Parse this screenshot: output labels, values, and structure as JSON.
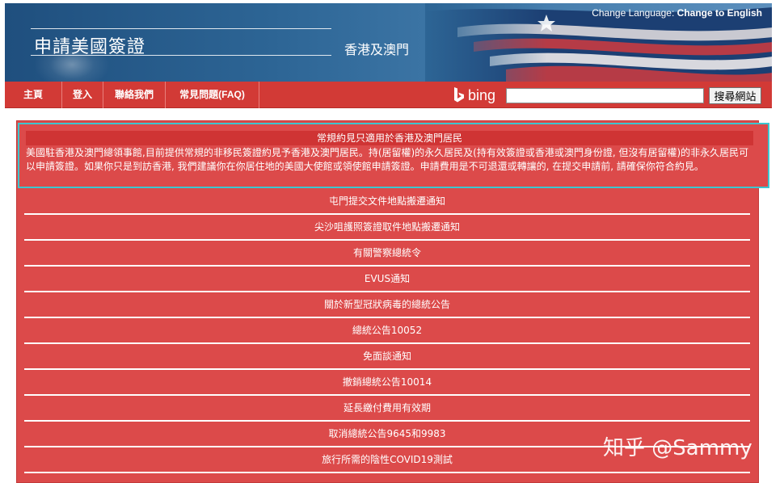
{
  "header": {
    "site_title": "申請美國簽證",
    "region": "香港及澳門",
    "language_prompt": "Change Language:",
    "language_link": "Change to English"
  },
  "nav": {
    "items": [
      {
        "label": "主頁"
      },
      {
        "label": "登入"
      },
      {
        "label": "聯絡我們"
      },
      {
        "label": "常見問題(FAQ)"
      }
    ],
    "bing_label": "bing",
    "search_value": "",
    "search_button": "搜尋網站"
  },
  "notice": {
    "title": "常規約見只適用於香港及澳門居民",
    "body": "美國駐香港及澳門總領事館,目前提供常規的非移民簽證約見予香港及澳門居民。持(居留權)的永久居民及(持有效簽證或香港或澳門身份證, 但沒有居留權)的非永久居民可以申請簽證。如果你只是到訪香港, 我們建議你在你居住地的美國大使館或領使館申請簽證。申請費用是不可退還或轉讓的, 在提交申請前, 請確保你符合約見。"
  },
  "menu": [
    {
      "label": "屯門提交文件地點搬遷通知"
    },
    {
      "label": "尖沙咀護照簽證取件地點搬遷通知"
    },
    {
      "label": "有關警察總統令"
    },
    {
      "label": "EVUS通知"
    },
    {
      "label": "關於新型冠狀病毒的總統公告"
    },
    {
      "label": "總統公告10052"
    },
    {
      "label": "免面談通知"
    },
    {
      "label": "撤銷總統公告10014"
    },
    {
      "label": "延長繳付費用有效期"
    },
    {
      "label": "取消總統公告9645和9983"
    },
    {
      "label": "旅行所需的陰性COVID19測試"
    }
  ],
  "watermark": "知乎 @Sammy",
  "colors": {
    "nav_red": "#d23a36",
    "panel_red": "#dc4a4a",
    "notice_border": "#3cc6cf",
    "header_blue": "#2d6595"
  }
}
